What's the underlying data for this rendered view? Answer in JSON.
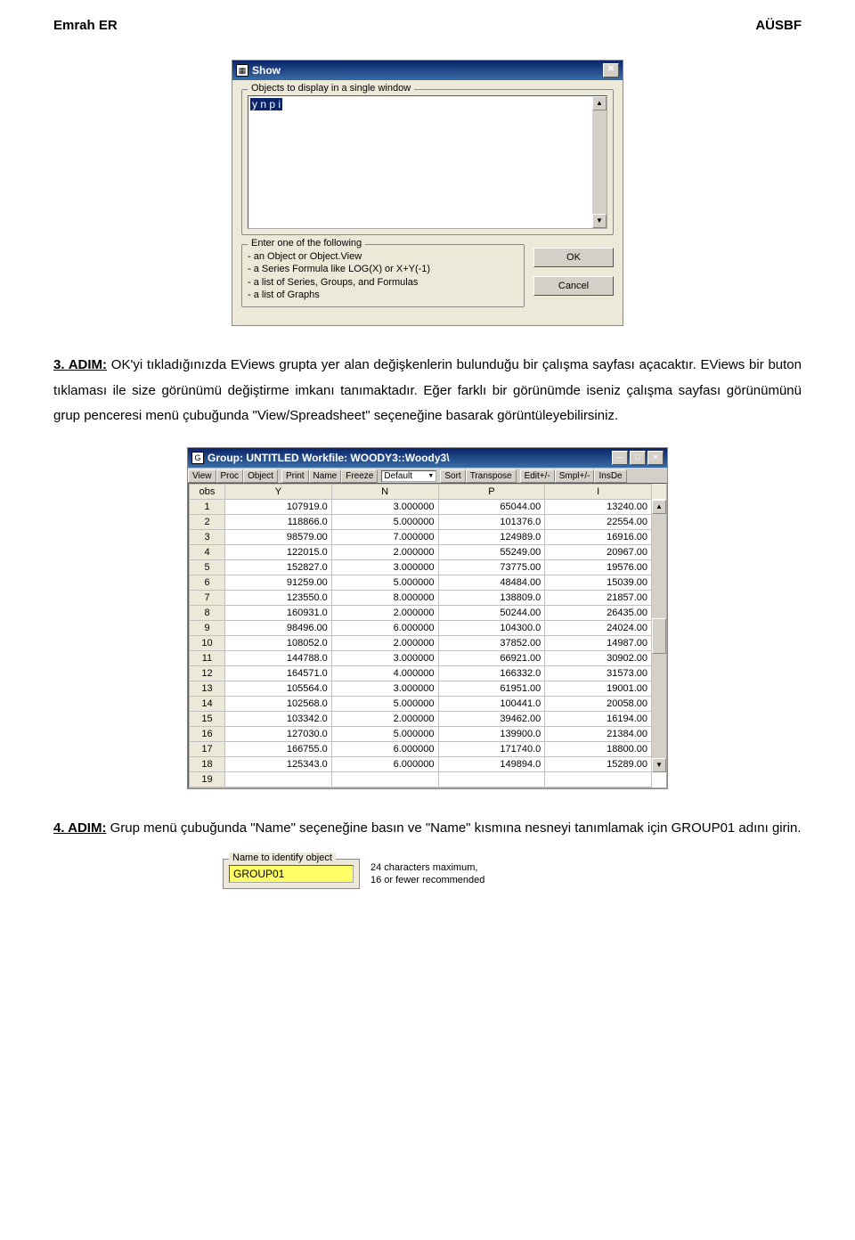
{
  "header": {
    "left": "Emrah ER",
    "right": "AÜSBF"
  },
  "dialog_show": {
    "title": "Show",
    "group1_label": "Objects to display in a single window",
    "textarea_value": "y n p i",
    "group2_label": "Enter one of the following",
    "hints": [
      "- an Object or Object.View",
      "- a Series Formula like LOG(X) or X+Y(-1)",
      "- a list of Series, Groups, and Formulas",
      "- a list of Graphs"
    ],
    "ok": "OK",
    "cancel": "Cancel"
  },
  "para1": {
    "step": "3. ADIM:",
    "text": " OK'yi tıkladığınızda EViews grupta yer alan değişkenlerin bulunduğu bir çalışma sayfası açacaktır. EViews bir buton tıklaması ile size görünümü değiştirme imkanı tanımaktadır. Eğer farklı bir görünümde iseniz çalışma sayfası görünümünü grup penceresi menü çubuğunda \"View/Spreadsheet\" seçeneğine basarak görüntüleyebilirsiniz."
  },
  "dialog_group": {
    "title": "Group: UNTITLED   Workfile: WOODY3::Woody3\\",
    "toolbar": {
      "view": "View",
      "proc": "Proc",
      "object": "Object",
      "print": "Print",
      "name": "Name",
      "freeze": "Freeze",
      "default": "Default",
      "sort": "Sort",
      "transpose": "Transpose",
      "edit": "Edit+/-",
      "smpl": "Smpl+/-",
      "insde": "InsDe"
    },
    "headers": [
      "obs",
      "Y",
      "N",
      "P",
      "I"
    ],
    "rows": [
      [
        "1",
        "107919.0",
        "3.000000",
        "65044.00",
        "13240.00"
      ],
      [
        "2",
        "118866.0",
        "5.000000",
        "101376.0",
        "22554.00"
      ],
      [
        "3",
        "98579.00",
        "7.000000",
        "124989.0",
        "16916.00"
      ],
      [
        "4",
        "122015.0",
        "2.000000",
        "55249.00",
        "20967.00"
      ],
      [
        "5",
        "152827.0",
        "3.000000",
        "73775.00",
        "19576.00"
      ],
      [
        "6",
        "91259.00",
        "5.000000",
        "48484.00",
        "15039.00"
      ],
      [
        "7",
        "123550.0",
        "8.000000",
        "138809.0",
        "21857.00"
      ],
      [
        "8",
        "160931.0",
        "2.000000",
        "50244.00",
        "26435.00"
      ],
      [
        "9",
        "98496.00",
        "6.000000",
        "104300.0",
        "24024.00"
      ],
      [
        "10",
        "108052.0",
        "2.000000",
        "37852.00",
        "14987.00"
      ],
      [
        "11",
        "144788.0",
        "3.000000",
        "66921.00",
        "30902.00"
      ],
      [
        "12",
        "164571.0",
        "4.000000",
        "166332.0",
        "31573.00"
      ],
      [
        "13",
        "105564.0",
        "3.000000",
        "61951.00",
        "19001.00"
      ],
      [
        "14",
        "102568.0",
        "5.000000",
        "100441.0",
        "20058.00"
      ],
      [
        "15",
        "103342.0",
        "2.000000",
        "39462.00",
        "16194.00"
      ],
      [
        "16",
        "127030.0",
        "5.000000",
        "139900.0",
        "21384.00"
      ],
      [
        "17",
        "166755.0",
        "6.000000",
        "171740.0",
        "18800.00"
      ],
      [
        "18",
        "125343.0",
        "6.000000",
        "149894.0",
        "15289.00"
      ],
      [
        "19",
        "",
        "",
        "",
        ""
      ]
    ]
  },
  "para2": {
    "step": "4. ADIM:",
    "text": " Grup menü çubuğunda \"Name\" seçeneğine basın ve \"Name\" kısmına nesneyi tanımlamak için GROUP01 adını girin."
  },
  "dialog_name": {
    "group_label": "Name to identify object",
    "input_value": "GROUP01",
    "hint1": "24 characters maximum,",
    "hint2": "16 or fewer recommended"
  }
}
